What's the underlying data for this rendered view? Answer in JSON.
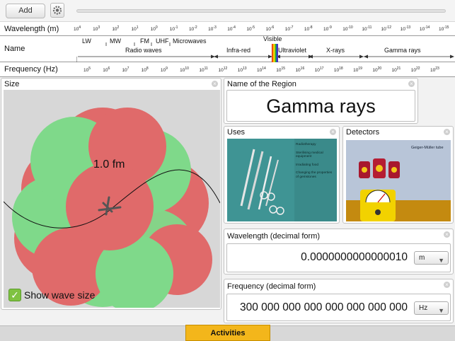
{
  "toolbar": {
    "add_label": "Add",
    "gear_icon": "gear-icon"
  },
  "scale": {
    "wavelength_label": "Wavelength (m)",
    "name_label": "Name",
    "frequency_label": "Frequency (Hz)",
    "wavelength_ticks": [
      {
        "base": "10",
        "exp": "4"
      },
      {
        "base": "10",
        "exp": "3"
      },
      {
        "base": "10",
        "exp": "2"
      },
      {
        "base": "10",
        "exp": "1"
      },
      {
        "base": "10",
        "exp": "0"
      },
      {
        "base": "10",
        "exp": "-1"
      },
      {
        "base": "10",
        "exp": "-2"
      },
      {
        "base": "10",
        "exp": "-3"
      },
      {
        "base": "10",
        "exp": "-4"
      },
      {
        "base": "10",
        "exp": "-5"
      },
      {
        "base": "10",
        "exp": "-6"
      },
      {
        "base": "10",
        "exp": "-7"
      },
      {
        "base": "10",
        "exp": "-8"
      },
      {
        "base": "10",
        "exp": "-9"
      },
      {
        "base": "10",
        "exp": "-10"
      },
      {
        "base": "10",
        "exp": "-11"
      },
      {
        "base": "10",
        "exp": "-12"
      },
      {
        "base": "10",
        "exp": "-13"
      },
      {
        "base": "10",
        "exp": "-14"
      },
      {
        "base": "10",
        "exp": "-15"
      }
    ],
    "frequency_ticks": [
      {
        "base": "10",
        "exp": "5"
      },
      {
        "base": "10",
        "exp": "6"
      },
      {
        "base": "10",
        "exp": "7"
      },
      {
        "base": "10",
        "exp": "8"
      },
      {
        "base": "10",
        "exp": "9"
      },
      {
        "base": "10",
        "exp": "10"
      },
      {
        "base": "10",
        "exp": "11"
      },
      {
        "base": "10",
        "exp": "12"
      },
      {
        "base": "10",
        "exp": "13"
      },
      {
        "base": "10",
        "exp": "14"
      },
      {
        "base": "10",
        "exp": "15"
      },
      {
        "base": "10",
        "exp": "16"
      },
      {
        "base": "10",
        "exp": "17"
      },
      {
        "base": "10",
        "exp": "18"
      },
      {
        "base": "10",
        "exp": "19"
      },
      {
        "base": "10",
        "exp": "20"
      },
      {
        "base": "10",
        "exp": "21"
      },
      {
        "base": "10",
        "exp": "22"
      },
      {
        "base": "10",
        "exp": "23"
      }
    ],
    "sub_bands": [
      "LW",
      "MW",
      "FM",
      "UHF",
      "Microwaves"
    ],
    "bands": [
      "Radio waves",
      "Infra-red",
      "Visible",
      "Ultraviolet",
      "X-rays",
      "Gamma rays"
    ]
  },
  "size_panel": {
    "title": "Size",
    "scale_label": "1.0 fm",
    "checkbox_label": "Show wave size",
    "checkbox_checked": true
  },
  "name_panel": {
    "title": "Name of the Region",
    "value": "Gamma rays"
  },
  "uses_panel": {
    "title": "Uses",
    "items": [
      "Radiotherapy",
      "Sterilising medical equipment",
      "Irradiating food",
      "Changing the properties of gemstones"
    ]
  },
  "detectors_panel": {
    "title": "Detectors",
    "caption": "Geiger-Müller tube"
  },
  "wavelength_panel": {
    "title": "Wavelength (decimal form)",
    "value": "0.0000000000000010",
    "unit": "m"
  },
  "frequency_panel": {
    "title": "Frequency (decimal form)",
    "value": "300 000 000 000 000 000 000 000",
    "unit": "Hz"
  },
  "bottom": {
    "activities_label": "Activities"
  },
  "colors": {
    "accent": "#f3b61b",
    "nucleus_red": "#e06a6a",
    "nucleus_green": "#7fd98a",
    "checkbox_green": "#7fc241"
  }
}
